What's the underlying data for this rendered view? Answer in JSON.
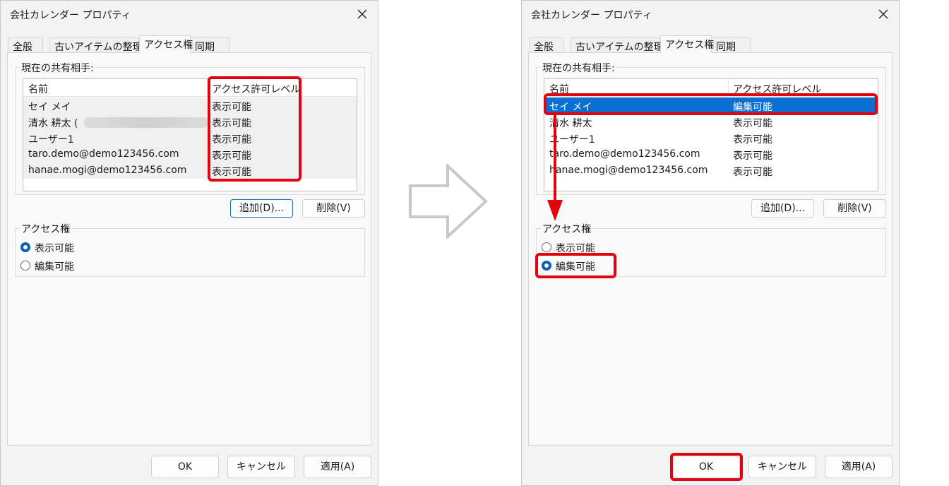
{
  "dialog_title": "会社カレンダー プロパティ",
  "tabs": [
    "全般",
    "古いアイテムの整理",
    "アクセス権",
    "同期"
  ],
  "active_tab": "アクセス権",
  "shared_label": "現在の共有相手:",
  "columns": {
    "name": "名前",
    "level": "アクセス許可レベル"
  },
  "before": {
    "rows": [
      {
        "name": "セイ メイ",
        "level": "表示可能"
      },
      {
        "name": "清水 耕太 (",
        "level": "表示可能",
        "blurred": true
      },
      {
        "name": "ユーザー1",
        "level": "表示可能"
      },
      {
        "name": "taro.demo@demo123456.com",
        "level": "表示可能"
      },
      {
        "name": "hanae.mogi@demo123456.com",
        "level": "表示可能"
      }
    ],
    "selected_radio": "表示可能"
  },
  "after": {
    "rows": [
      {
        "name": "セイ メイ",
        "level": "編集可能",
        "selected": true
      },
      {
        "name": "清水 耕太",
        "level": "表示可能"
      },
      {
        "name": "ユーザー1",
        "level": "表示可能"
      },
      {
        "name": "taro.demo@demo123456.com",
        "level": "表示可能"
      },
      {
        "name": "hanae.mogi@demo123456.com",
        "level": "表示可能"
      }
    ],
    "selected_radio": "編集可能"
  },
  "buttons": {
    "add": "追加(D)...",
    "remove": "削除(V)",
    "ok": "OK",
    "cancel": "キャンセル",
    "apply": "適用(A)"
  },
  "permission_group_label": "アクセス権",
  "radio_options": [
    "表示可能",
    "編集可能"
  ],
  "colors": {
    "highlight": "#e3000f",
    "selection": "#0a6fd0",
    "radio_checked": "#0a5fb4",
    "arrow_outline": "#c8c8c8"
  }
}
